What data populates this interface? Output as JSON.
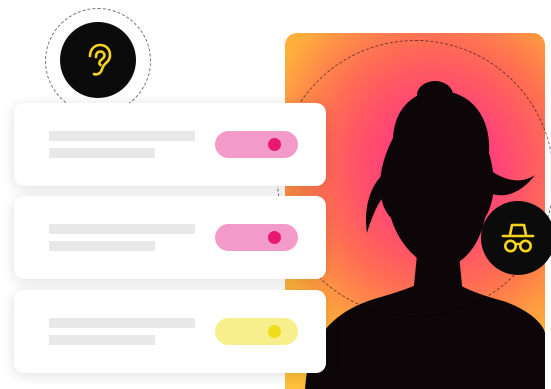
{
  "colors": {
    "accent_yellow": "#f7d51d",
    "pink_track": "#f49ac8",
    "pink_knob": "#e8196e",
    "yellow_track": "#f6ef8c",
    "yellow_knob": "#f1dc1a",
    "dark_circle": "#0b0b0b",
    "gradient_pink": "#ff2f86",
    "gradient_orange": "#ffb13a"
  },
  "icons": {
    "top": "ear-icon",
    "side": "incognito-spy-icon"
  },
  "cards": [
    {
      "toggle_color": "pink",
      "toggle_state": "on"
    },
    {
      "toggle_color": "pink",
      "toggle_state": "on"
    },
    {
      "toggle_color": "yellow",
      "toggle_state": "on"
    }
  ]
}
